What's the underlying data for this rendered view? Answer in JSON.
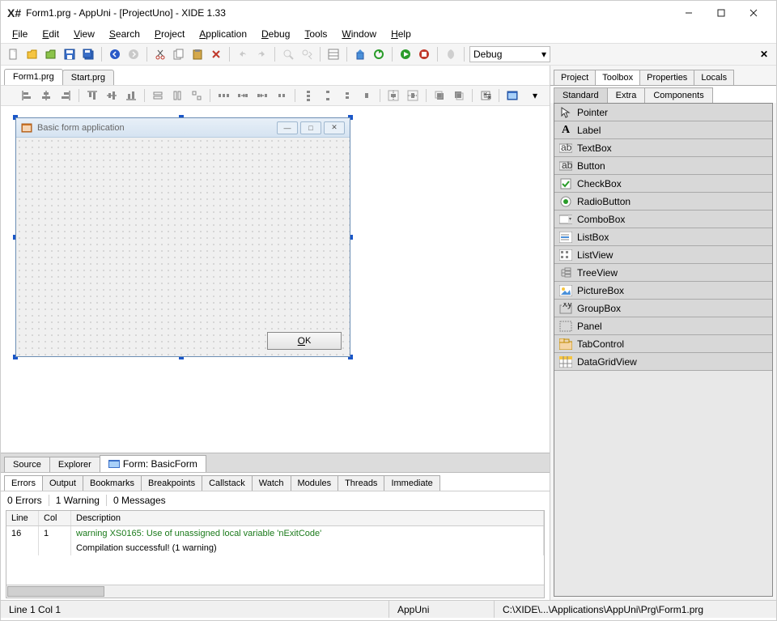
{
  "window": {
    "title": "Form1.prg - AppUni - [ProjectUno] - XIDE 1.33",
    "logo": "X#"
  },
  "menubar": [
    "File",
    "Edit",
    "View",
    "Search",
    "Project",
    "Application",
    "Debug",
    "Tools",
    "Window",
    "Help"
  ],
  "toolbar": {
    "configLabel": "Debug"
  },
  "editorTabs": {
    "t0": "Form1.prg",
    "t1": "Start.prg"
  },
  "designForm": {
    "title": "Basic form application",
    "okLabel": "OK"
  },
  "bottomTabs": {
    "t0": "Source",
    "t1": "Explorer",
    "t2": "Form: BasicForm"
  },
  "outputTabs": [
    "Errors",
    "Output",
    "Bookmarks",
    "Breakpoints",
    "Callstack",
    "Watch",
    "Modules",
    "Threads",
    "Immediate"
  ],
  "errorsSummary": {
    "errors": "0 Errors",
    "warnings": "1 Warning",
    "messages": "0 Messages"
  },
  "errorsHeader": {
    "line": "Line",
    "col": "Col",
    "desc": "Description"
  },
  "errorsRows": {
    "r0": {
      "line": "16",
      "col": "1",
      "desc": "warning XS0165: Use of unassigned local variable 'nExitCode'"
    },
    "r1": {
      "line": "",
      "col": "",
      "desc": "Compilation successful! (1 warning)"
    }
  },
  "rightTabs": [
    "Project",
    "Toolbox",
    "Properties",
    "Locals"
  ],
  "rightSubTabs": [
    "Standard",
    "Extra",
    "Components"
  ],
  "toolbox": [
    "Pointer",
    "Label",
    "TextBox",
    "Button",
    "CheckBox",
    "RadioButton",
    "ComboBox",
    "ListBox",
    "ListView",
    "TreeView",
    "PictureBox",
    "GroupBox",
    "Panel",
    "TabControl",
    "DataGridView"
  ],
  "status": {
    "pos": "Line 1  Col 1",
    "app": "AppUni",
    "path": "C:\\XIDE\\...\\Applications\\AppUni\\Prg\\Form1.prg"
  }
}
